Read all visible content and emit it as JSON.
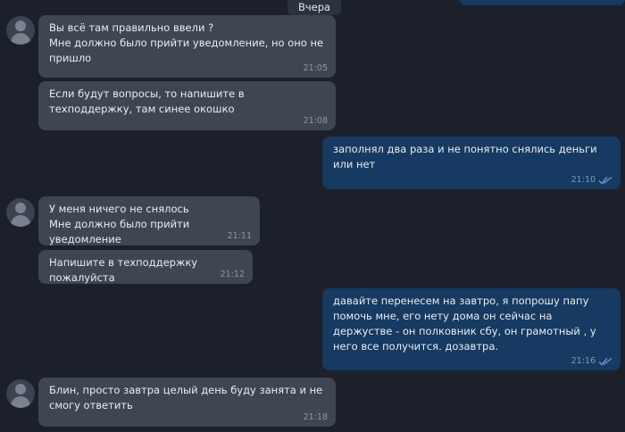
{
  "date_separator": "Вчера",
  "messages": [
    {
      "from": "in",
      "text": "Вы всё там правильно ввели ?\nМне должно было прийти уведомление, но оно не пришло",
      "time": "21:05"
    },
    {
      "from": "in",
      "text": "Если будут вопросы, то напишите в техподдержку, там синее окошко",
      "time": "21:08"
    },
    {
      "from": "out",
      "text": "заполнял два раза и не понятно снялись деньги или нет",
      "time": "21:10",
      "status": "read-checkmarks-icon"
    },
    {
      "from": "in",
      "text": "У меня ничего не снялось\nМне должно было прийти уведомление",
      "time": "21:11"
    },
    {
      "from": "in",
      "text": "Напишите в техподдержку пожалуйста",
      "time": "21:12"
    },
    {
      "from": "out",
      "text": "давайте перенесем на завтро, я попрошу папу помочь мне, его нету дома он сейчас на держустве - он полковник сбу, он грамотный , у него все получится. дозавтра.",
      "time": "21:16",
      "status": "read-checkmarks-icon"
    },
    {
      "from": "in",
      "text": "Блин, просто завтра целый день буду занята и не смогу ответить",
      "time": "21:18"
    }
  ],
  "colors": {
    "background": "#1b202b",
    "incoming_bubble": "#3e4652",
    "outgoing_bubble": "#163a61",
    "read_checkmarks": "#6f93d6"
  }
}
